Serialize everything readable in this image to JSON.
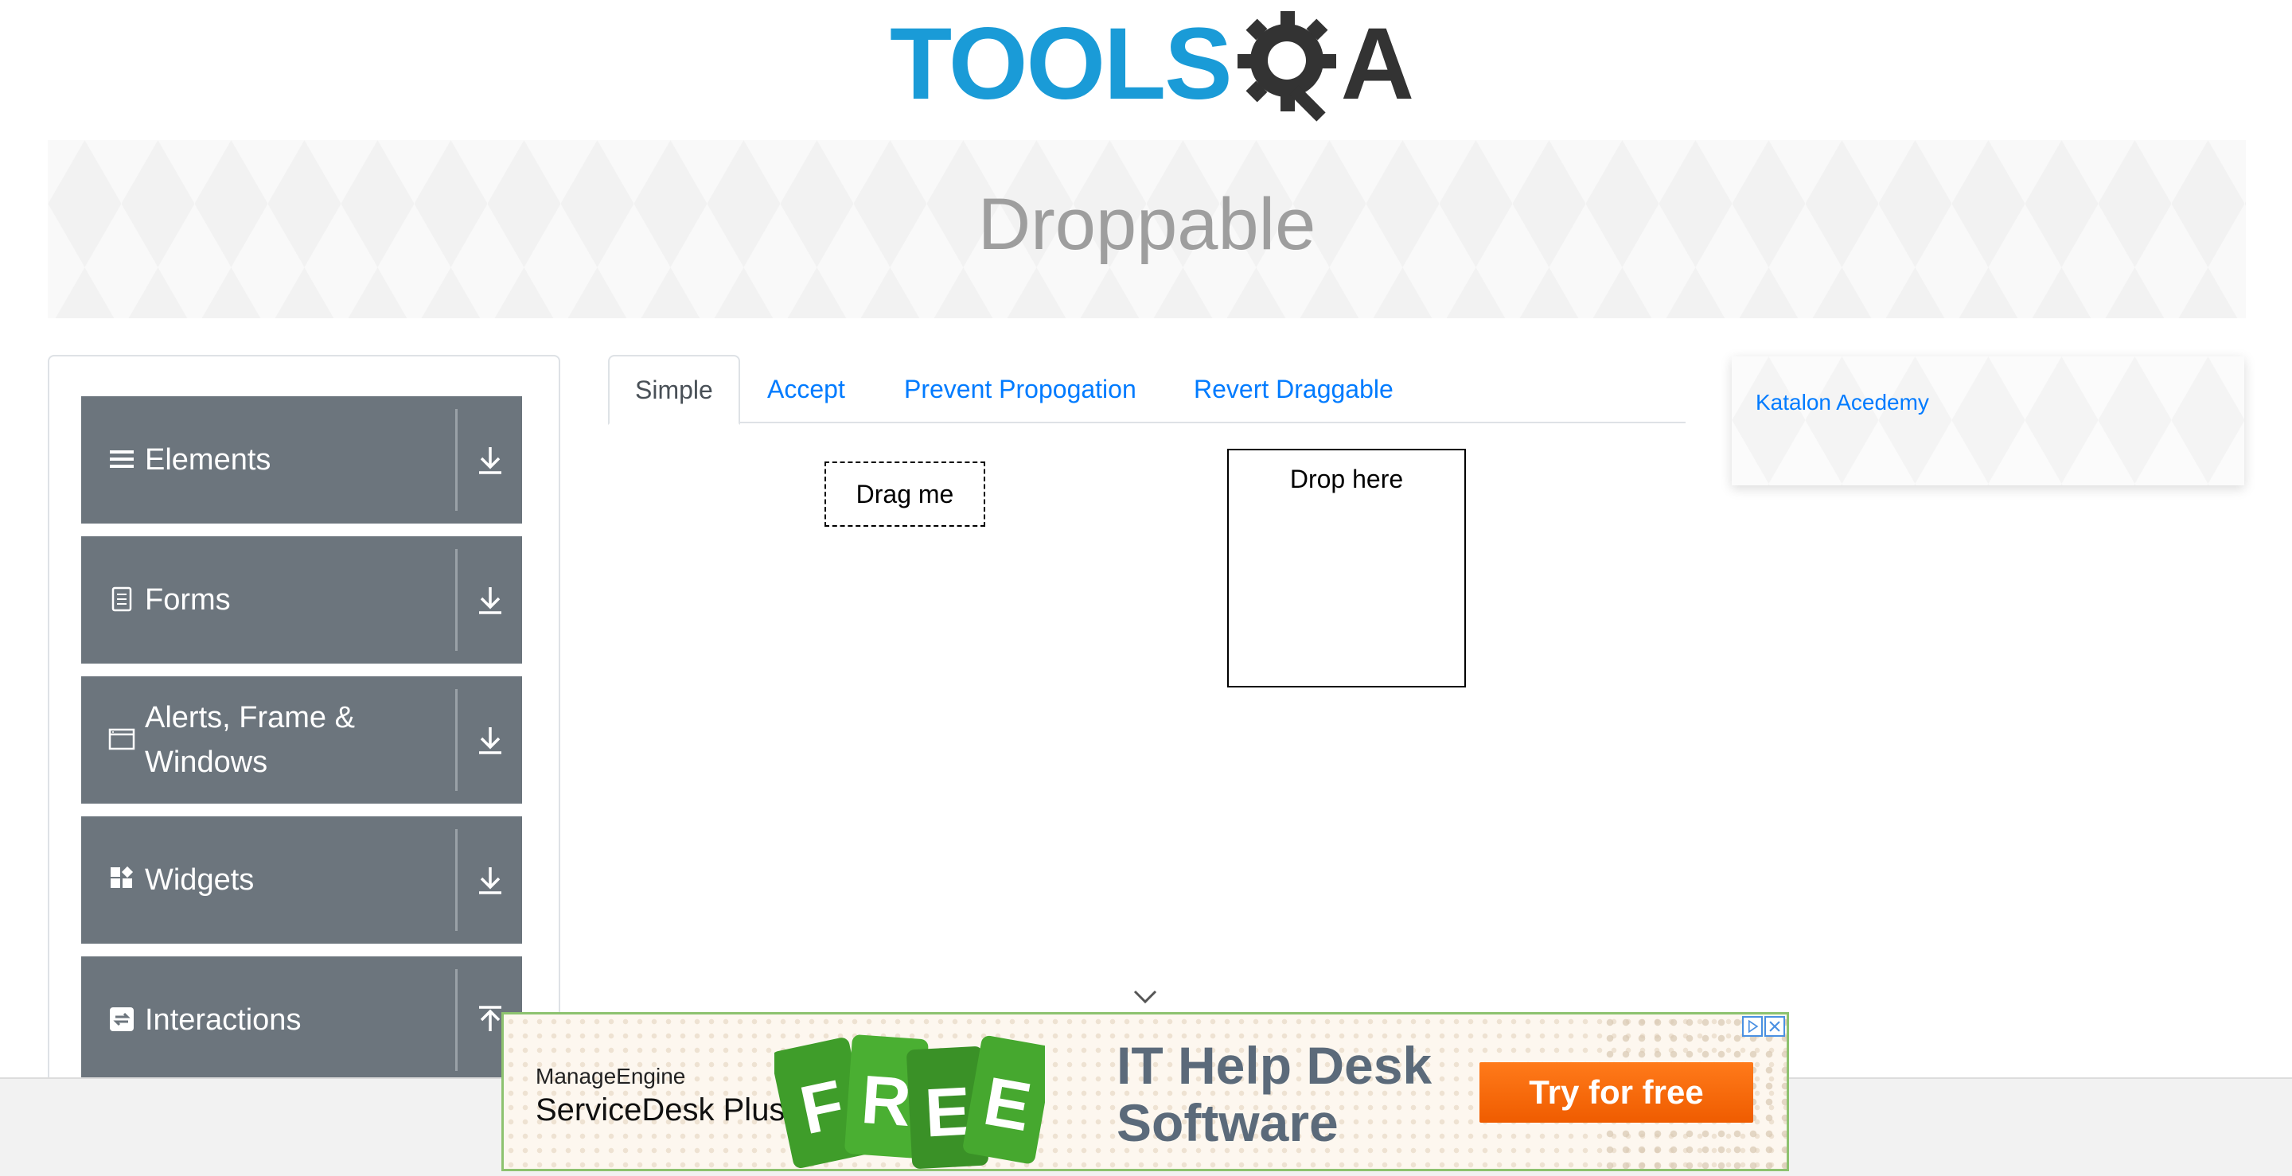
{
  "logo": {
    "text_main": "TOOLS",
    "text_q": "Q",
    "text_a": "A"
  },
  "banner": {
    "title": "Droppable"
  },
  "sidebar": {
    "groups": [
      {
        "label": "Elements",
        "icon": "list-icon",
        "arrow": "download-arrow-icon"
      },
      {
        "label": "Forms",
        "icon": "document-icon",
        "arrow": "download-arrow-icon"
      },
      {
        "label": "Alerts, Frame & Windows",
        "icon": "window-icon",
        "arrow": "download-arrow-icon"
      },
      {
        "label": "Widgets",
        "icon": "widgets-icon",
        "arrow": "download-arrow-icon"
      },
      {
        "label": "Interactions",
        "icon": "interactions-icon",
        "arrow": "upload-arrow-icon"
      }
    ]
  },
  "tabs": [
    {
      "label": "Simple",
      "active": true
    },
    {
      "label": "Accept",
      "active": false
    },
    {
      "label": "Prevent Propogation",
      "active": false
    },
    {
      "label": "Revert Draggable",
      "active": false
    }
  ],
  "draggable": {
    "label": "Drag me"
  },
  "droppable": {
    "label": "Drop here"
  },
  "right_panel": {
    "link": "Katalon Acedemy"
  },
  "ad": {
    "brand": "ManageEngine",
    "product": "ServiceDesk Plus",
    "tag_letters": [
      "F",
      "R",
      "E",
      "E"
    ],
    "headline_line1": "IT Help Desk",
    "headline_line2": "Software",
    "cta": "Try for free"
  },
  "colors": {
    "logo_blue": "#1a9bd7",
    "sidebar_group": "#6c757d",
    "link_blue": "#007bff",
    "cta_orange": "#ff7a1a",
    "tag_green": "#3f9d2a"
  }
}
